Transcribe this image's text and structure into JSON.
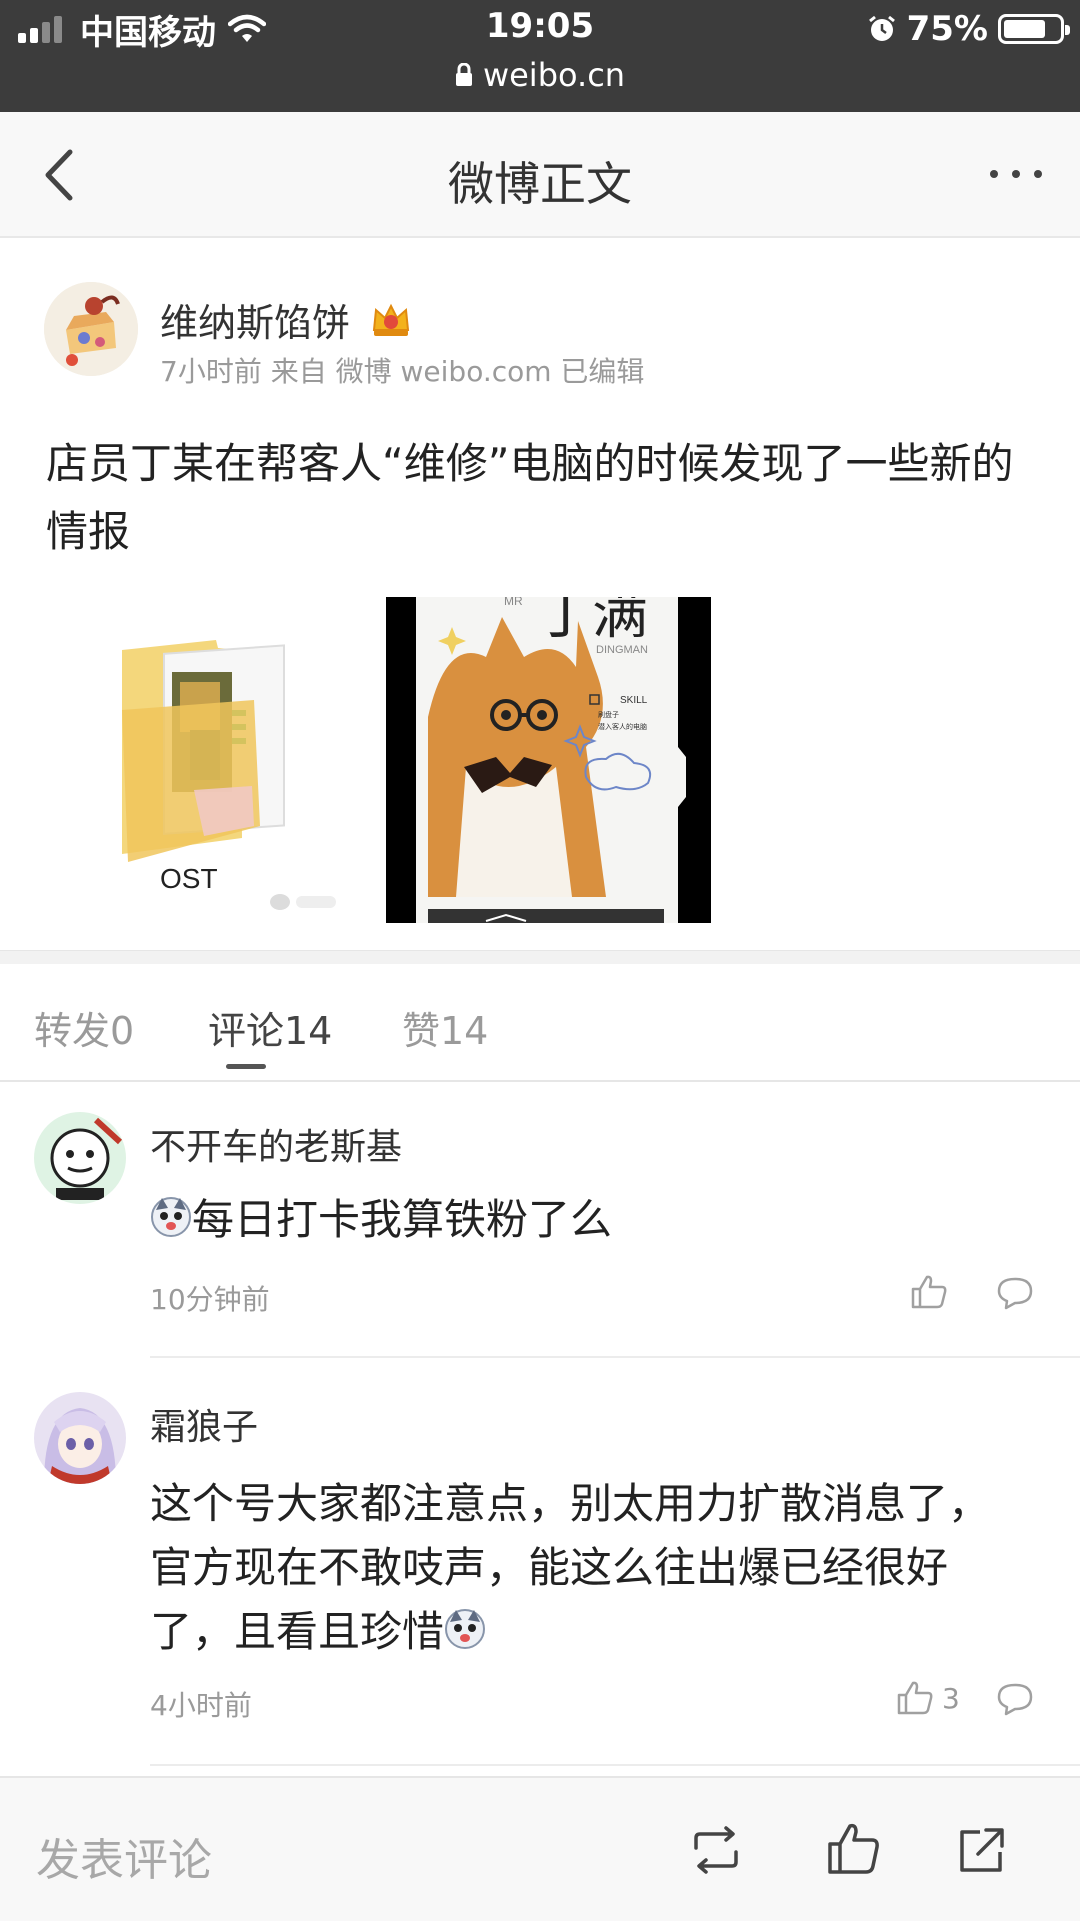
{
  "status_bar": {
    "carrier": "中国移动",
    "time": "19:05",
    "battery_percent": "75%",
    "battery_level": 0.75,
    "url": "weibo.cn"
  },
  "nav": {
    "title": "微博正文"
  },
  "post": {
    "author": "维纳斯馅饼",
    "meta": "7小时前 来自 微博 weibo.com 已编辑",
    "text": "店员丁某在帮客人“维修”电脑的时候发现了一些新的情报",
    "images": [
      {
        "caption": "OST"
      },
      {
        "title": "丁满",
        "title_small": "MR",
        "subtitle": "DINGMAN",
        "skill_label": "SKILL",
        "skill_items": [
          "刷盘子",
          "潜入客人的电脑"
        ]
      }
    ]
  },
  "tabs": [
    {
      "label": "转发0",
      "active": false
    },
    {
      "label": "评论14",
      "active": true
    },
    {
      "label": "赞14",
      "active": false
    }
  ],
  "comments": [
    {
      "name": "不开车的老斯基",
      "text": "每日打卡我算铁粉了么",
      "emoji_position": "start",
      "time": "10分钟前",
      "likes": ""
    },
    {
      "name": "霜狼子",
      "text": "这个号大家都注意点，别太用力扩散消息了，官方现在不敢吱声，能这么往出爆已经很好了，且看且珍惜",
      "emoji_position": "end",
      "time": "4小时前",
      "likes": "3"
    }
  ],
  "bottom_bar": {
    "comment_placeholder": "发表评论",
    "icons": [
      "repost-icon",
      "like-icon",
      "share-icon"
    ]
  }
}
